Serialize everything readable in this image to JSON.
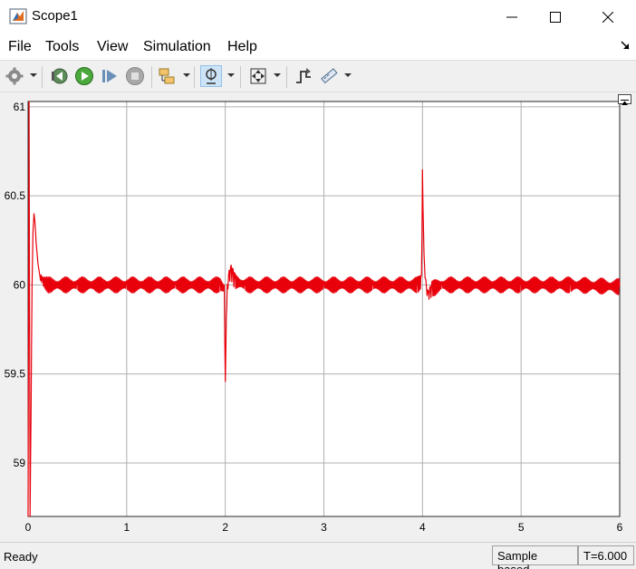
{
  "window": {
    "title": "Scope1"
  },
  "menu": {
    "file": "File",
    "tools": "Tools",
    "view": "View",
    "simulation": "Simulation",
    "help": "Help"
  },
  "toolbar": {
    "icons": [
      "gear-icon",
      "step-back-icon",
      "run-icon",
      "step-forward-icon",
      "stop-icon",
      "signal-selector-icon",
      "zoom-icon",
      "fit-to-view-icon",
      "triggers-icon",
      "measurements-icon"
    ]
  },
  "status": {
    "ready": "Ready",
    "sample_mode": "Sample based",
    "time": "T=6.000"
  },
  "colors": {
    "trace": "#e8000b",
    "plot_bg": "#ffffff",
    "grid": "#b0b0b0",
    "frame_bg": "#f0f0f0"
  },
  "chart_data": {
    "type": "line",
    "title": "",
    "xlabel": "",
    "ylabel": "",
    "xlim": [
      0,
      6
    ],
    "ylim": [
      58.7,
      61.03
    ],
    "x_ticks": [
      "0",
      "1",
      "2",
      "3",
      "4",
      "5",
      "6"
    ],
    "y_ticks": [
      "59",
      "59.5",
      "60",
      "60.5",
      "61"
    ],
    "grid": true,
    "series": [
      {
        "color": "#e8000b",
        "x": [
          0,
          0.01,
          0.02,
          0.03,
          0.04,
          0.05,
          0.06,
          0.07,
          0.08,
          0.1,
          0.12,
          0.15,
          0.2,
          0.25,
          0.3,
          0.5,
          0.8,
          1.0,
          1.5,
          1.95,
          1.99,
          2.0,
          2.01,
          2.02,
          2.04,
          2.06,
          2.08,
          2.1,
          2.2,
          2.5,
          3.0,
          3.5,
          3.95,
          3.99,
          4.0,
          4.01,
          4.02,
          4.04,
          4.06,
          4.08,
          4.1,
          4.2,
          4.5,
          5.0,
          5.5,
          6.0
        ],
        "y": [
          58.7,
          61.03,
          58.7,
          59.3,
          60.0,
          60.3,
          60.4,
          60.35,
          60.25,
          60.12,
          60.05,
          60.02,
          60.0,
          60.0,
          60.0,
          60.0,
          60.0,
          60.0,
          60.0,
          60.0,
          59.98,
          59.44,
          59.8,
          59.98,
          60.05,
          60.07,
          60.04,
          60.02,
          60.0,
          60.0,
          60.0,
          60.0,
          60.0,
          60.02,
          60.62,
          60.3,
          60.1,
          59.97,
          59.94,
          59.96,
          59.98,
          60.0,
          60.0,
          60.0,
          60.0,
          59.99
        ]
      }
    ]
  }
}
